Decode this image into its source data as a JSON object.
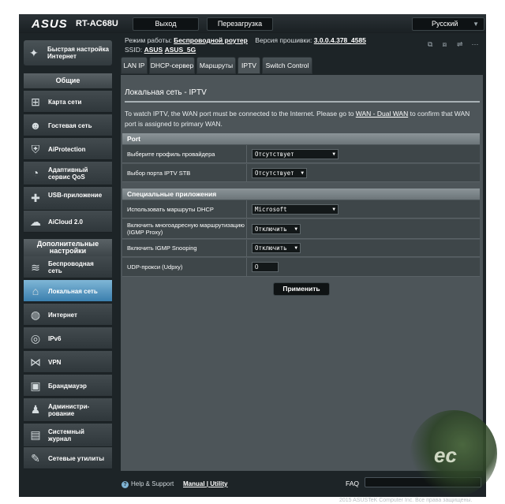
{
  "header": {
    "brand": "ASUS",
    "model": "RT-AC68U",
    "logout_label": "Выход",
    "reboot_label": "Перезагрузка",
    "language": "Русский"
  },
  "status": {
    "mode_label": "Режим работы:",
    "mode_value": "Беспроводной роутер",
    "firmware_label": "Версия прошивки:",
    "firmware_value": "3.0.0.4.378_4585",
    "ssid_label": "SSID:",
    "ssid_1": "ASUS",
    "ssid_2": "ASUS_5G"
  },
  "sidebar": {
    "quick_setup": "Быстрая настройка Интернет",
    "general_header": "Общие",
    "general_items": [
      {
        "label": "Карта сети",
        "icon": "network-map-icon"
      },
      {
        "label": "Гостевая сеть",
        "icon": "guest-network-icon"
      },
      {
        "label": "AiProtection",
        "icon": "aiprotection-icon"
      },
      {
        "label": "Адаптивный сервис QoS",
        "icon": "qos-icon"
      },
      {
        "label": "USB-приложение",
        "icon": "usb-app-icon"
      },
      {
        "label": "AiCloud 2.0",
        "icon": "aicloud-icon"
      }
    ],
    "advanced_header": "Дополнительные настройки",
    "advanced_items": [
      {
        "label": "Беспроводная сеть",
        "icon": "wireless-icon"
      },
      {
        "label": "Локальная сеть",
        "icon": "lan-icon"
      },
      {
        "label": "Интернет",
        "icon": "wan-icon"
      },
      {
        "label": "IPv6",
        "icon": "ipv6-icon"
      },
      {
        "label": "VPN",
        "icon": "vpn-icon"
      },
      {
        "label": "Брандмауэр",
        "icon": "firewall-icon"
      },
      {
        "label": "Администри-рование",
        "icon": "admin-icon"
      },
      {
        "label": "Системный журнал",
        "icon": "syslog-icon"
      },
      {
        "label": "Сетевые утилиты",
        "icon": "tools-icon"
      }
    ]
  },
  "tabs": [
    "LAN IP",
    "DHCP-сервер",
    "Маршруты",
    "IPTV",
    "Switch Control"
  ],
  "active_tab": "IPTV",
  "main": {
    "title": "Локальная сеть - IPTV",
    "desc_before": "To watch IPTV, the WAN port must be connected to the Internet. Please go to ",
    "desc_link": "WAN - Dual WAN",
    "desc_after": " to confirm that WAN port is assigned to primary WAN.",
    "port_header": "Port",
    "port_rows": [
      {
        "label": "Выберите профиль провайдера",
        "value": "Отсутствует"
      },
      {
        "label": "Выбор порта IPTV STB",
        "value": "Отсутствует"
      }
    ],
    "apps_header": "Специальные приложения",
    "apps_rows": [
      {
        "label": "Использовать маршруты DHCP",
        "value": "Microsoft"
      },
      {
        "label": "Включить многоадресную маршрутизацию (IGMP Proxy)",
        "value": "Отключить"
      },
      {
        "label": "Включить IGMP Snooping",
        "value": "Отключить"
      },
      {
        "label": "UDP-прокси (Udpxy)",
        "value": "0"
      }
    ],
    "apply_label": "Применить"
  },
  "footer": {
    "help": "Help & Support",
    "manual": "Manual",
    "separator": "|",
    "utility": "Utility",
    "faq": "FAQ",
    "copyright": "2015 ASUSTeK Computer Inc. Все права защищены."
  },
  "colors": {
    "background": "#1d2427",
    "panel": "#4d5559",
    "active_nav": "#3a7fae",
    "section_header": "#7b8488"
  }
}
